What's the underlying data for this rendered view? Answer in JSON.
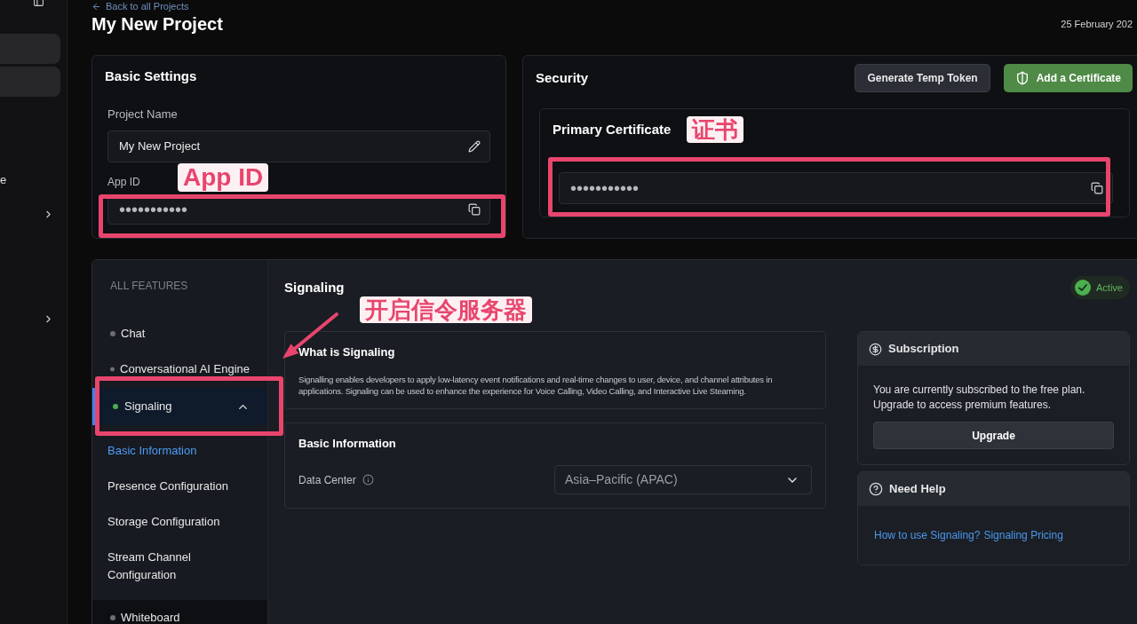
{
  "sidebar": {
    "items": [
      {
        "selected": true,
        "expandable": false
      },
      {
        "selected": true,
        "expandable": false
      },
      {
        "label": "e",
        "selected": false,
        "expandable": false
      },
      {
        "selected": false,
        "expandable": true
      },
      {
        "selected": false,
        "expandable": true
      }
    ]
  },
  "header": {
    "back_link": "Back to all Projects",
    "title": "My New Project",
    "date": "25 February 202"
  },
  "basic_settings": {
    "title": "Basic Settings",
    "fields": [
      {
        "label": "Project Name",
        "value": "My New Project",
        "kind": "editable"
      },
      {
        "label": "App ID",
        "value": "•••••••••••",
        "kind": "secret"
      }
    ]
  },
  "security": {
    "title": "Security",
    "buttons": [
      {
        "label": "Generate Temp Token",
        "kind": "secondary"
      },
      {
        "label": "Add a Certificate",
        "kind": "primary"
      }
    ],
    "certificate": {
      "title": "Primary Certificate",
      "value": "•••••••••••",
      "kind": "secret"
    }
  },
  "features": {
    "heading": "ALL FEATURES",
    "items": [
      {
        "label": "Chat",
        "enabled": false,
        "selected": false,
        "expanded": false,
        "hovered": false
      },
      {
        "label": "Conversational AI Engine",
        "enabled": false,
        "selected": false,
        "expanded": false,
        "hovered": false
      },
      {
        "label": "Signaling",
        "enabled": true,
        "selected": true,
        "expanded": true,
        "hovered": false,
        "children": [
          {
            "label": "Basic Information",
            "selected": true
          },
          {
            "label": "Presence Configuration",
            "selected": false
          },
          {
            "label": "Storage Configuration",
            "selected": false
          },
          {
            "label": "Stream Channel Configuration",
            "selected": false
          }
        ]
      },
      {
        "label": "Whiteboard",
        "enabled": false,
        "selected": false,
        "expanded": false,
        "hovered": true
      }
    ]
  },
  "signaling": {
    "title": "Signaling",
    "status": {
      "label": "Active",
      "active": true
    },
    "about": {
      "title": "What is Signaling",
      "text": "Signalling enables developers to apply low-latency event notifications and real-time changes to user, device, and channel attributes in applications. Signaling can be used to enhance the experience for Voice Calling, Video Calling, and Interactive Live Steaming."
    },
    "basic_information": {
      "title": "Basic Information",
      "fields": [
        {
          "label": "Data Center",
          "value": "Asia–Pacific (APAC)"
        }
      ]
    },
    "subscription": {
      "title": "Subscription",
      "text": "You are currently subscribed to the free plan. Upgrade to access premium features.",
      "button": "Upgrade"
    },
    "help": {
      "title": "Need Help",
      "links": [
        "How to use Signaling?",
        "Signaling Pricing"
      ]
    }
  },
  "annotations": [
    {
      "text": "App ID"
    },
    {
      "text": "证书"
    },
    {
      "text": "开启信令服务器"
    }
  ]
}
